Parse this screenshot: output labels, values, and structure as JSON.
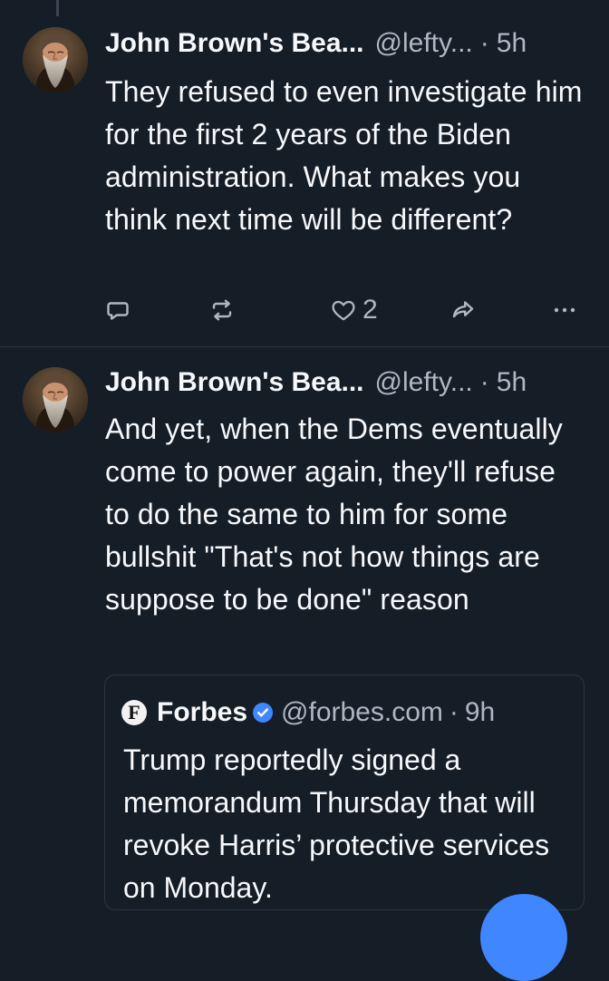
{
  "posts": [
    {
      "author": "John Brown's Bea...",
      "handle": "@lefty...",
      "separator": "·",
      "time": "5h",
      "text": "They refused to even investigate him for the first 2 years of the Biden administration. What makes you think next time will be different?",
      "like_count": "2",
      "icons": {
        "reply": "reply-icon",
        "repost": "repost-icon",
        "like": "heart-icon",
        "share": "share-icon",
        "more": "more-icon"
      }
    },
    {
      "author": "John Brown's Bea...",
      "handle": "@lefty...",
      "separator": "·",
      "time": "5h",
      "text": "And yet, when the Dems eventually come to power again, they'll refuse to do the same to him for some bullshit \"That's not how things are suppose to be done\" reason",
      "quote": {
        "logo_text": "F",
        "author": "Forbes",
        "handle": "@forbes.com",
        "separator": "·",
        "time": "9h",
        "text": "Trump reportedly signed a memorandum Thursday that will revoke Harris’ protective services on Monday."
      }
    }
  ],
  "colors": {
    "background": "#151d27",
    "primary_text": "#f7f8fa",
    "secondary_text": "#aeb8c4",
    "divider": "#2b3541",
    "accent": "#3f86ff"
  }
}
